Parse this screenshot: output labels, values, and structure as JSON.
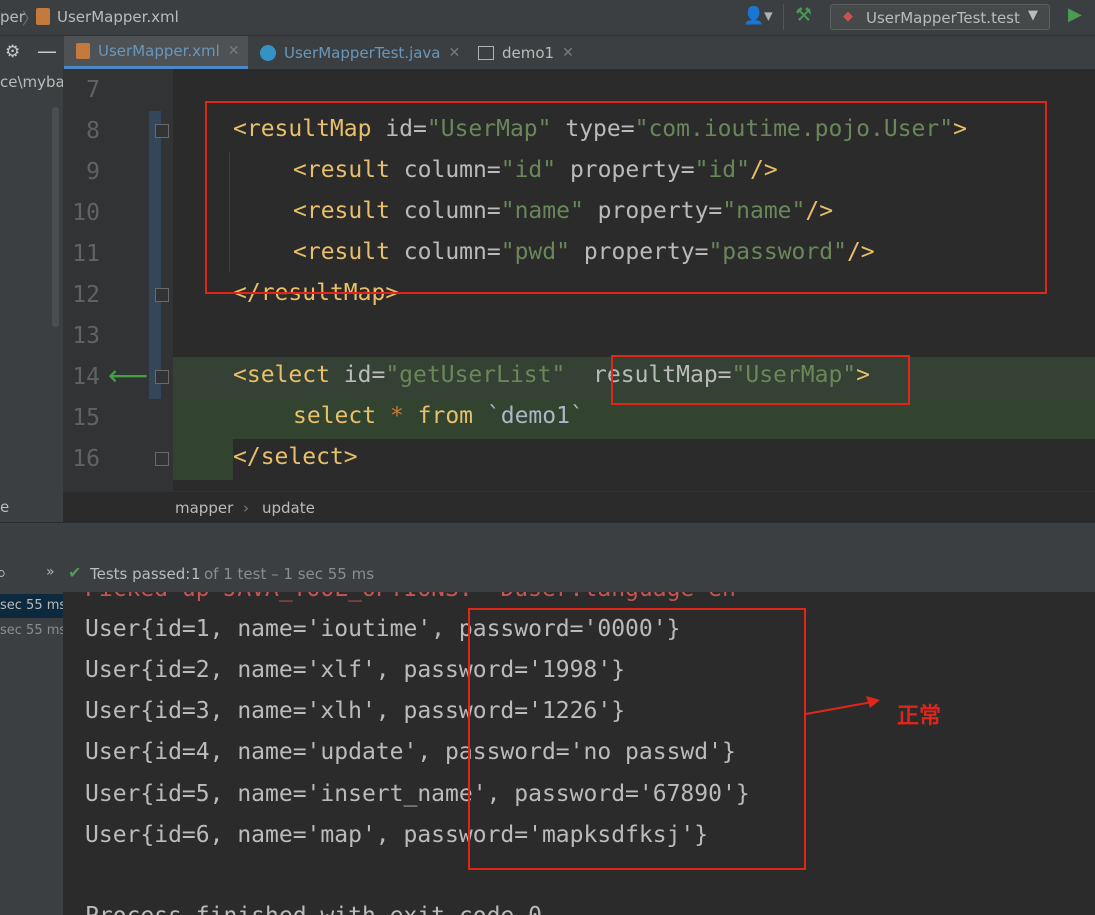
{
  "topbar": {
    "crumb_project": "per",
    "crumb_file": "UserMapper.xml",
    "run_config": "UserMapperTest.test"
  },
  "tabs": [
    {
      "label": "UserMapper.xml",
      "active": true
    },
    {
      "label": "UserMapperTest.java",
      "active": false
    },
    {
      "label": "demo1",
      "active": false
    }
  ],
  "project_panel": {
    "path_fragment": "ce\\mybat",
    "item_fragment": "e"
  },
  "editor": {
    "line_numbers": [
      "7",
      "8",
      "9",
      "10",
      "11",
      "12",
      "13",
      "14",
      "15",
      "16"
    ],
    "lines": {
      "l8": {
        "tag_open": "<resultMap",
        "a1": " id=",
        "v1": "\"UserMap\"",
        "a2": " type=",
        "v2": "\"com.ioutime.pojo.User\"",
        "close": ">"
      },
      "l9": {
        "tag_open": "<result",
        "a1": " column=",
        "v1": "\"id\"",
        "a2": " property=",
        "v2": "\"id\"",
        "close": "/>"
      },
      "l10": {
        "tag_open": "<result",
        "a1": " column=",
        "v1": "\"name\"",
        "a2": " property=",
        "v2": "\"name\"",
        "close": "/>"
      },
      "l11": {
        "tag_open": "<result",
        "a1": " column=",
        "v1": "\"pwd\"",
        "a2": " property=",
        "v2": "\"password\"",
        "close": "/>"
      },
      "l12": {
        "text": "</resultMap>"
      },
      "l14": {
        "tag_open": "<select",
        "a1": " id=",
        "v1": "\"getUserList\"",
        "a2": "  resultMap=",
        "v2": "\"UserMap\"",
        "close": ">"
      },
      "l15": {
        "kw1": "select",
        "op": " * ",
        "kw2": "from",
        "table": " `demo1`"
      },
      "l16": {
        "text": "</select>"
      }
    },
    "breadcrumb": [
      "mapper",
      "update"
    ]
  },
  "run": {
    "status_label": "Tests passed:",
    "status_count": "1",
    "status_detail": "of 1 test – 1 sec 55 ms",
    "tree_times": [
      "sec 55 ms",
      "sec 55 ms"
    ],
    "console_lines": [
      "Picked up JAVA_TOOL_OPTIONS: -Duser.language=en",
      "User{id=1, name='ioutime', password='0000'}",
      "User{id=2, name='xlf', password='1998'}",
      "User{id=3, name='xlh', password='1226'}",
      "User{id=4, name='update', password='no passwd'}",
      "User{id=5, name='insert_name', password='67890'}",
      "User{id=6, name='map', password='mapksdfksj'}",
      "Process finished with exit code 0"
    ],
    "annotation": "正常"
  },
  "colors": {
    "annotation_red": "#e0261b",
    "tag": "#e8bf6a",
    "value": "#6a8759",
    "keyword": "#cc7832"
  }
}
